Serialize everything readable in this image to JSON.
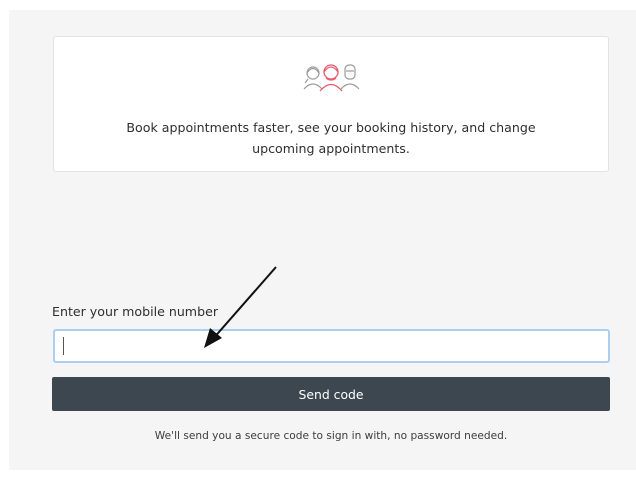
{
  "info_card": {
    "icon": "people-group-icon",
    "accent_color": "#e85a6b",
    "text": "Book appointments faster, see your booking history, and change upcoming appointments."
  },
  "form": {
    "label": "Enter your mobile number",
    "input_value": "",
    "input_placeholder": "",
    "submit_label": "Send code",
    "helper_text": "We'll send you a secure code to sign in with, no password needed."
  },
  "annotation": {
    "icon": "arrow-icon"
  }
}
